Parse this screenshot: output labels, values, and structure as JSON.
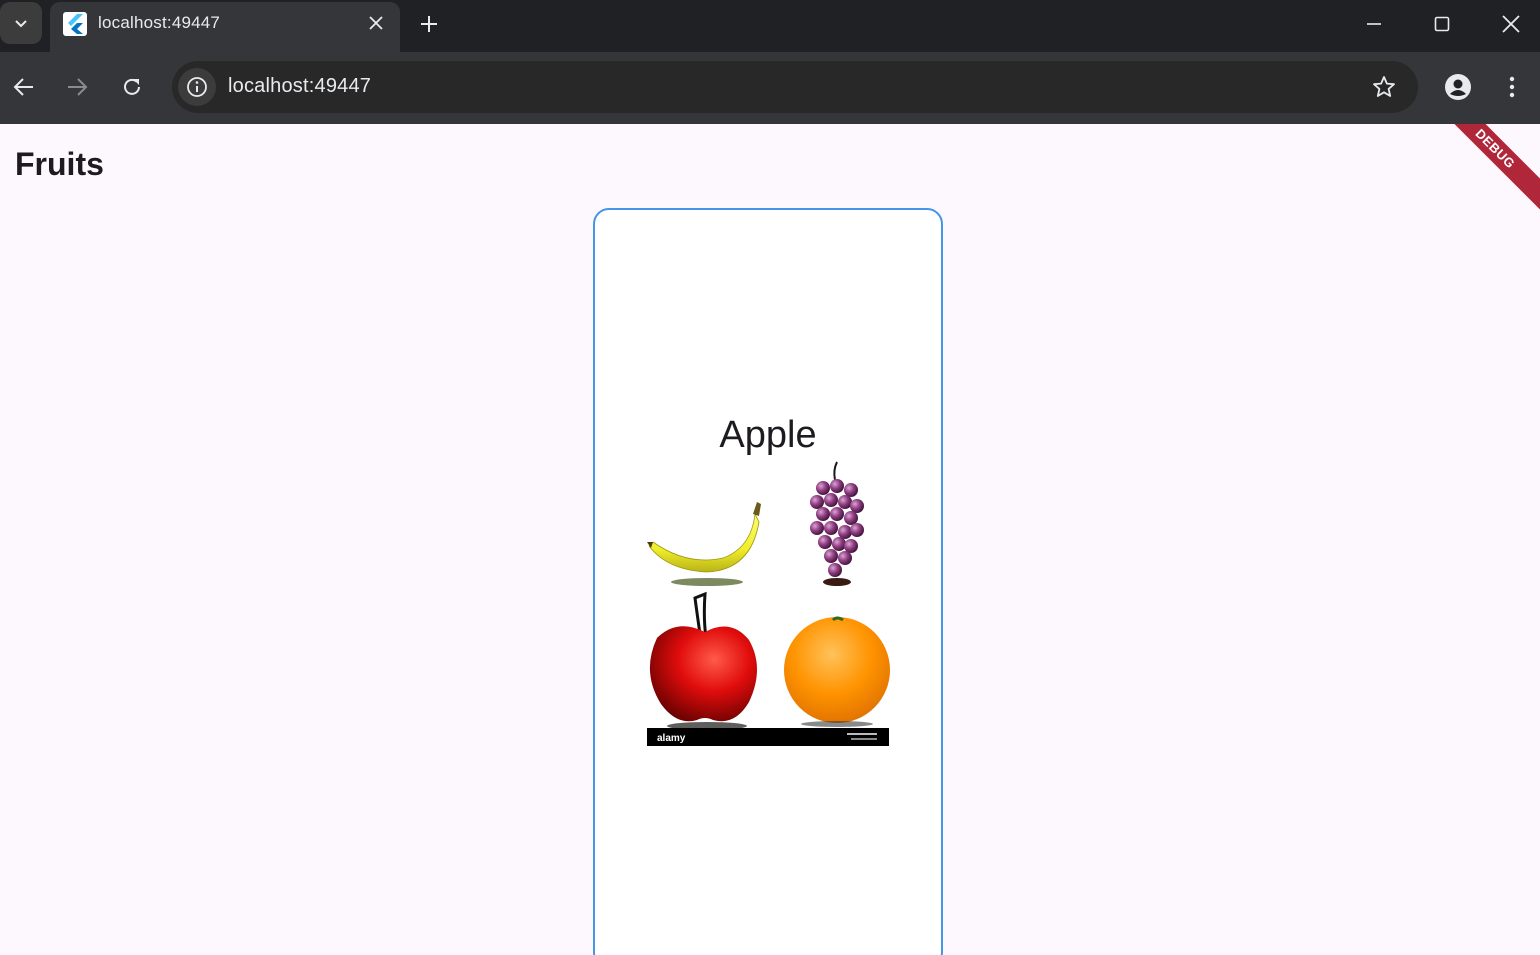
{
  "browser": {
    "tab_title": "localhost:49447",
    "url": "localhost:49447",
    "icons": [
      "tab-search-icon",
      "flutter-favicon-icon",
      "close-icon",
      "plus-icon",
      "minimize-icon",
      "maximize-icon",
      "window-close-icon",
      "back-arrow-icon",
      "forward-arrow-icon",
      "reload-icon",
      "info-icon",
      "star-icon",
      "profile-icon",
      "more-vert-icon"
    ]
  },
  "app": {
    "title": "Fruits",
    "debug_label": "DEBUG",
    "card": {
      "fruit_name": "Apple",
      "image_watermark": "alamy",
      "border_color": "#4596e9"
    }
  }
}
